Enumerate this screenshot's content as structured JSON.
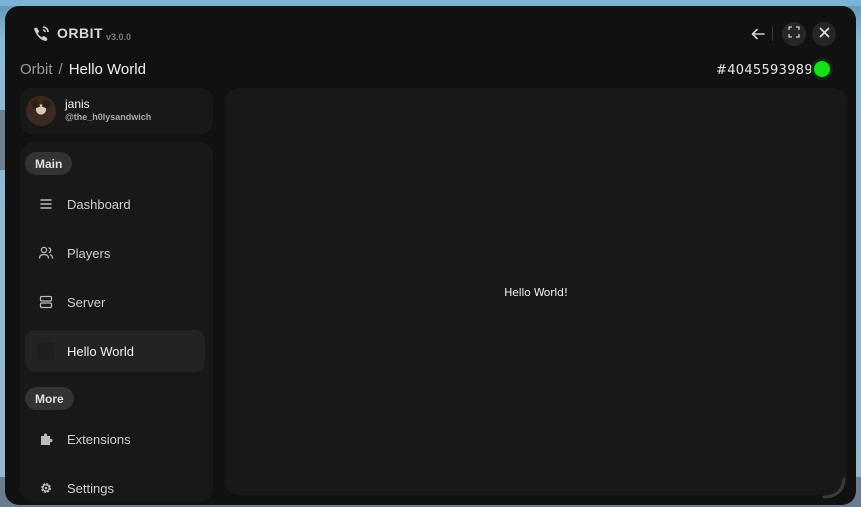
{
  "app": {
    "name": "ORBIT",
    "version": "v3.0.0",
    "icon": "phone-satellite-icon"
  },
  "titlebar": {
    "back_icon": "arrow-left-icon",
    "fullscreen_icon": "fullscreen-icon",
    "close_icon": "close-icon"
  },
  "breadcrumb": {
    "root": "Orbit",
    "separator": "/",
    "current": "Hello World"
  },
  "server": {
    "id": "#4045593989",
    "status_color": "#15e01a"
  },
  "user": {
    "name": "janis",
    "handle": "@the_h0lysandwich"
  },
  "sidebar": {
    "sections": [
      {
        "label": "Main",
        "items": [
          {
            "label": "Dashboard",
            "icon": "list-icon",
            "active": false
          },
          {
            "label": "Players",
            "icon": "users-icon",
            "active": false
          },
          {
            "label": "Server",
            "icon": "server-icon",
            "active": false
          },
          {
            "label": "Hello World",
            "icon": "blank-icon",
            "active": true
          }
        ]
      },
      {
        "label": "More",
        "items": [
          {
            "label": "Extensions",
            "icon": "puzzle-icon",
            "active": false
          },
          {
            "label": "Settings",
            "icon": "gear-icon",
            "active": false
          }
        ]
      }
    ]
  },
  "main": {
    "text": "Hello World!"
  },
  "colors": {
    "window_bg": "#111111",
    "panel_bg": "#181818",
    "active_item_bg": "#232323",
    "pill_bg": "#333333"
  }
}
